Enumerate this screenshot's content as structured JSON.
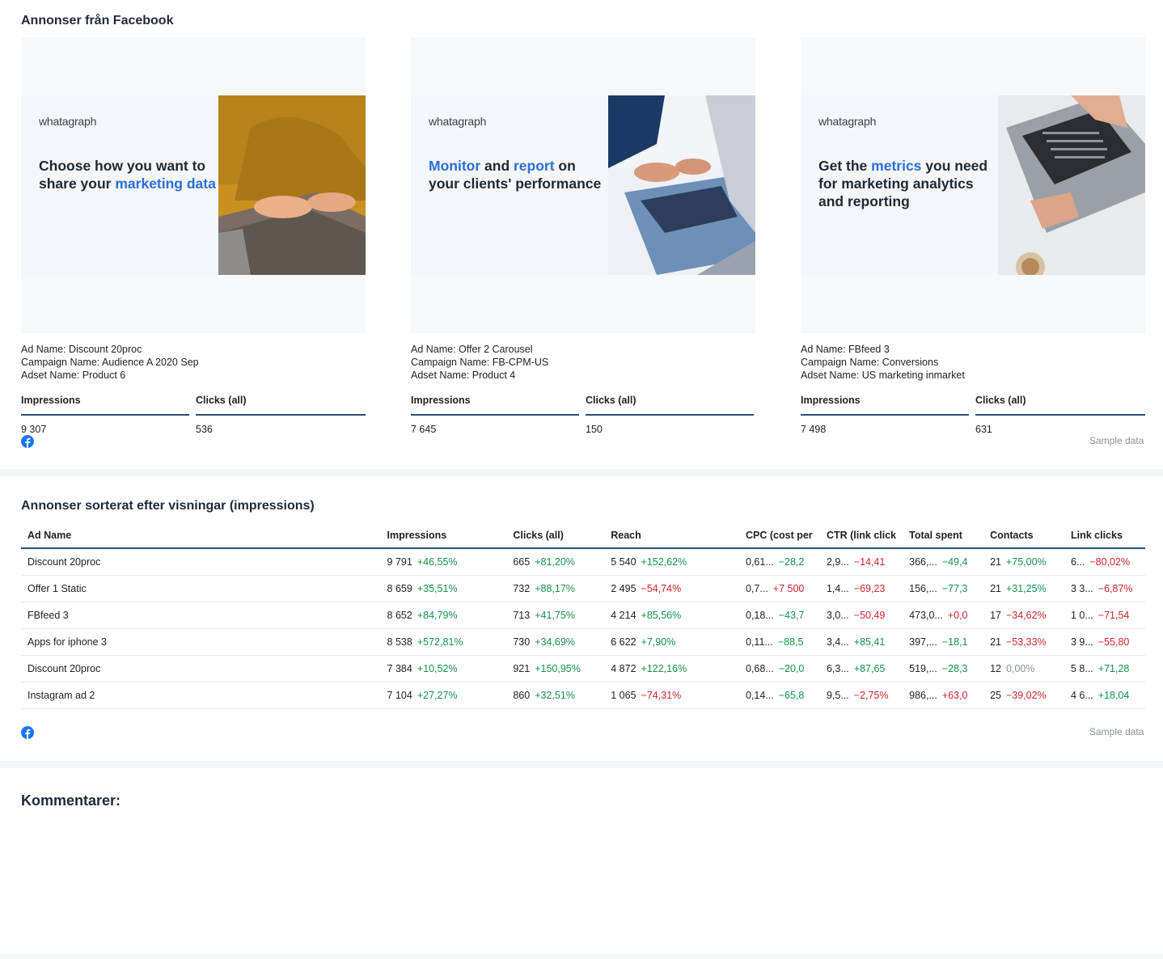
{
  "sections": {
    "ads_title": "Annonser från Facebook",
    "table_title": "Annonser sorterat efter visningar (impressions)",
    "comments_title": "Kommentarer:"
  },
  "ads": [
    {
      "brand": "whatagraph",
      "headline": [
        {
          "text": "Choose how you ",
          "highlight": false
        },
        {
          "text": "want to share your ",
          "highlight": false
        },
        {
          "text": "marketing data",
          "highlight": true
        }
      ],
      "ad_name": "Ad Name: Discount 20proc",
      "campaign_name": "Campaign Name: Audience A 2020 Sep",
      "adset_name": "Adset Name: Product 6",
      "impressions_label": "Impressions",
      "clicks_label": "Clicks (all)",
      "impressions": "9 307",
      "clicks": "536"
    },
    {
      "brand": "whatagraph",
      "headline": [
        {
          "text": "Monitor",
          "highlight": true
        },
        {
          "text": " and ",
          "highlight": false
        },
        {
          "text": "report",
          "highlight": true
        },
        {
          "text": " on your clients' performance",
          "highlight": false
        }
      ],
      "ad_name": "Ad Name: Offer 2 Carousel",
      "campaign_name": "Campaign Name: FB-CPM-US",
      "adset_name": "Adset Name: Product 4",
      "impressions_label": "Impressions",
      "clicks_label": "Clicks (all)",
      "impressions": "7 645",
      "clicks": "150"
    },
    {
      "brand": "whatagraph",
      "headline": [
        {
          "text": "Get the ",
          "highlight": false
        },
        {
          "text": "metrics",
          "highlight": true
        },
        {
          "text": " you need for marketing analytics and reporting",
          "highlight": false
        }
      ],
      "ad_name": "Ad Name: FBfeed 3",
      "campaign_name": "Campaign Name: Conversions",
      "adset_name": "Adset Name: US marketing inmarket",
      "impressions_label": "Impressions",
      "clicks_label": "Clicks (all)",
      "impressions": "7 498",
      "clicks": "631"
    }
  ],
  "sample_note": "Sample data",
  "table": {
    "columns": [
      "Ad Name",
      "Impressions",
      "Clicks (all)",
      "Reach",
      "CPC (cost per",
      "CTR (link click",
      "Total spent",
      "Contacts",
      "Link clicks"
    ],
    "rows": [
      {
        "name": "Discount 20proc",
        "cells": [
          {
            "v": "9 791",
            "d": "+46,55%",
            "t": "up"
          },
          {
            "v": "665",
            "d": "+81,20%",
            "t": "up"
          },
          {
            "v": "5 540",
            "d": "+152,62%",
            "t": "up"
          },
          {
            "v": "0,61...",
            "d": "−28,2",
            "t": "up"
          },
          {
            "v": "2,9...",
            "d": "−14,41",
            "t": "down"
          },
          {
            "v": "366,...",
            "d": "−49,4",
            "t": "up"
          },
          {
            "v": "21",
            "d": "+75,00%",
            "t": "up"
          },
          {
            "v": "6...",
            "d": "−80,02%",
            "t": "down"
          }
        ]
      },
      {
        "name": "Offer 1 Static",
        "cells": [
          {
            "v": "8 659",
            "d": "+35,51%",
            "t": "up"
          },
          {
            "v": "732",
            "d": "+88,17%",
            "t": "up"
          },
          {
            "v": "2 495",
            "d": "−54,74%",
            "t": "down"
          },
          {
            "v": "0,7...",
            "d": "+7 500",
            "t": "down"
          },
          {
            "v": "1,4...",
            "d": "−69,23",
            "t": "down"
          },
          {
            "v": "156,...",
            "d": "−77,3",
            "t": "up"
          },
          {
            "v": "21",
            "d": "+31,25%",
            "t": "up"
          },
          {
            "v": "3 3...",
            "d": "−6,87%",
            "t": "down"
          }
        ]
      },
      {
        "name": "FBfeed 3",
        "cells": [
          {
            "v": "8 652",
            "d": "+84,79%",
            "t": "up"
          },
          {
            "v": "713",
            "d": "+41,75%",
            "t": "up"
          },
          {
            "v": "4 214",
            "d": "+85,56%",
            "t": "up"
          },
          {
            "v": "0,18...",
            "d": "−43,7",
            "t": "up"
          },
          {
            "v": "3,0...",
            "d": "−50,49",
            "t": "down"
          },
          {
            "v": "473,0...",
            "d": "+0,0",
            "t": "down"
          },
          {
            "v": "17",
            "d": "−34,62%",
            "t": "down"
          },
          {
            "v": "1 0...",
            "d": "−71,54",
            "t": "down"
          }
        ]
      },
      {
        "name": "Apps for iphone 3",
        "cells": [
          {
            "v": "8 538",
            "d": "+572,81%",
            "t": "up"
          },
          {
            "v": "730",
            "d": "+34,69%",
            "t": "up"
          },
          {
            "v": "6 622",
            "d": "+7,90%",
            "t": "up"
          },
          {
            "v": "0,11...",
            "d": "−88,5",
            "t": "up"
          },
          {
            "v": "3,4...",
            "d": "+85,41",
            "t": "up"
          },
          {
            "v": "397,...",
            "d": "−18,1",
            "t": "up"
          },
          {
            "v": "21",
            "d": "−53,33%",
            "t": "down"
          },
          {
            "v": "3 9...",
            "d": "−55,80",
            "t": "down"
          }
        ]
      },
      {
        "name": "Discount 20proc",
        "cells": [
          {
            "v": "7 384",
            "d": "+10,52%",
            "t": "up"
          },
          {
            "v": "921",
            "d": "+150,95%",
            "t": "up"
          },
          {
            "v": "4 872",
            "d": "+122,16%",
            "t": "up"
          },
          {
            "v": "0,68...",
            "d": "−20,0",
            "t": "up"
          },
          {
            "v": "6,3...",
            "d": "+87,65",
            "t": "up"
          },
          {
            "v": "519,...",
            "d": "−28,3",
            "t": "up"
          },
          {
            "v": "12",
            "d": "0,00%",
            "t": "flat"
          },
          {
            "v": "5 8...",
            "d": "+71,28",
            "t": "up"
          }
        ]
      },
      {
        "name": "Instagram ad 2",
        "cells": [
          {
            "v": "7 104",
            "d": "+27,27%",
            "t": "up"
          },
          {
            "v": "860",
            "d": "+32,51%",
            "t": "up"
          },
          {
            "v": "1 065",
            "d": "−74,31%",
            "t": "down"
          },
          {
            "v": "0,14...",
            "d": "−65,8",
            "t": "up"
          },
          {
            "v": "9,5...",
            "d": "−2,75%",
            "t": "down"
          },
          {
            "v": "986,...",
            "d": "+63,0",
            "t": "down"
          },
          {
            "v": "25",
            "d": "−39,02%",
            "t": "down"
          },
          {
            "v": "4 6...",
            "d": "+18,04",
            "t": "up"
          }
        ]
      }
    ]
  },
  "colors": {
    "accent": "#2b6fd6",
    "positive": "#12924d",
    "negative": "#d4242c",
    "facebook": "#1877f2",
    "rule": "#25507a"
  }
}
